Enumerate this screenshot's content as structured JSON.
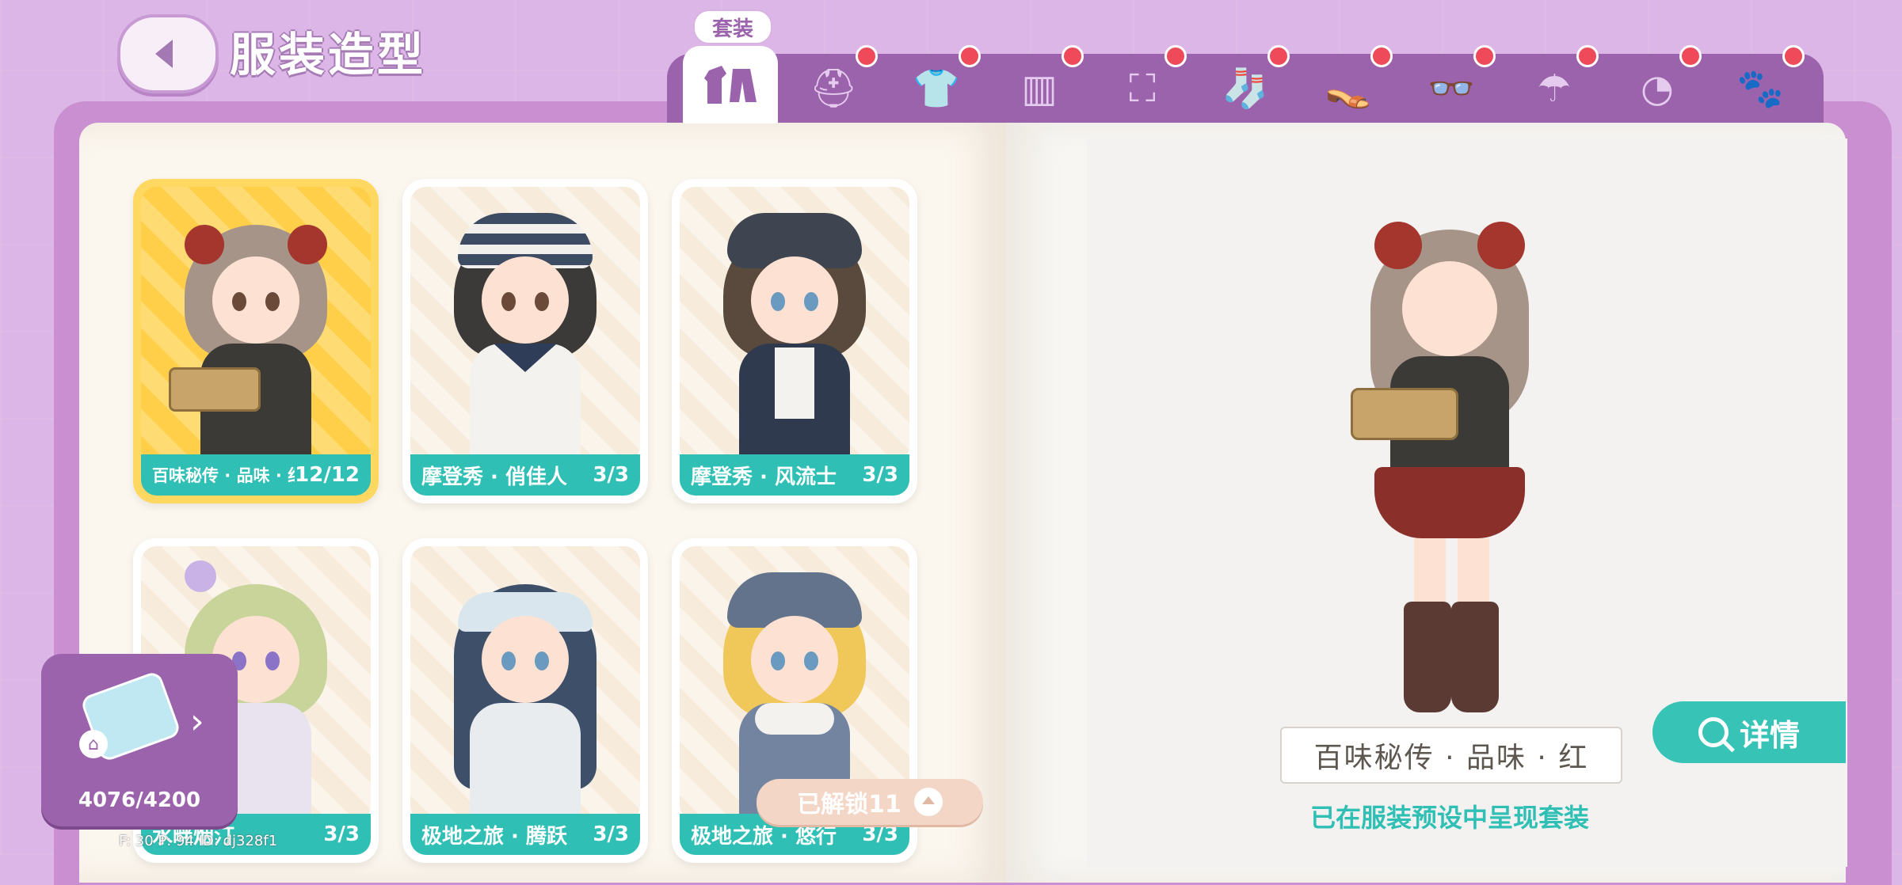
{
  "header": {
    "title": "服装造型"
  },
  "tabs": {
    "active_label": "套装",
    "items": [
      {
        "name": "outfit-set",
        "icon": "outfit-icon"
      },
      {
        "name": "hat",
        "icon": "hat-icon"
      },
      {
        "name": "top",
        "icon": "shirt-icon"
      },
      {
        "name": "pants",
        "icon": "pants-icon"
      },
      {
        "name": "overalls",
        "icon": "overalls-icon"
      },
      {
        "name": "socks",
        "icon": "socks-icon"
      },
      {
        "name": "shoes",
        "icon": "slippers-icon"
      },
      {
        "name": "glasses",
        "icon": "glasses-icon"
      },
      {
        "name": "umbrella",
        "icon": "umbrella-icon"
      },
      {
        "name": "hair",
        "icon": "hair-icon"
      },
      {
        "name": "pet-outfit",
        "icon": "paw-shirt-icon"
      }
    ]
  },
  "cards": [
    {
      "name": "百味秘传 · 品味 · 红",
      "count": "12/12",
      "selected": true
    },
    {
      "name": "摩登秀 · 俏佳人",
      "count": "3/3",
      "selected": false
    },
    {
      "name": "摩登秀 · 风流士",
      "count": "3/3",
      "selected": false
    },
    {
      "name": "水畔烟汀",
      "count": "3/3",
      "selected": false
    },
    {
      "name": "极地之旅 · 腾跃",
      "count": "3/3",
      "selected": false
    },
    {
      "name": "极地之旅 · 悠行",
      "count": "3/3",
      "selected": false
    }
  ],
  "preview": {
    "name": "百味秘传 · 品味 · 红",
    "note": "已在服装预设中呈现套装",
    "detail_label": "详情"
  },
  "puzzle": {
    "value": "4076/4200"
  },
  "unlocked": {
    "label": "已解锁11"
  },
  "debug": {
    "text": "F: 30  P: 94   ID: dj328f1"
  },
  "colors": {
    "accent_teal": "#2fbfb5",
    "purple": "#9c63ad",
    "selected_yellow": "#ffd862",
    "notify_red": "#ef4a5a"
  }
}
